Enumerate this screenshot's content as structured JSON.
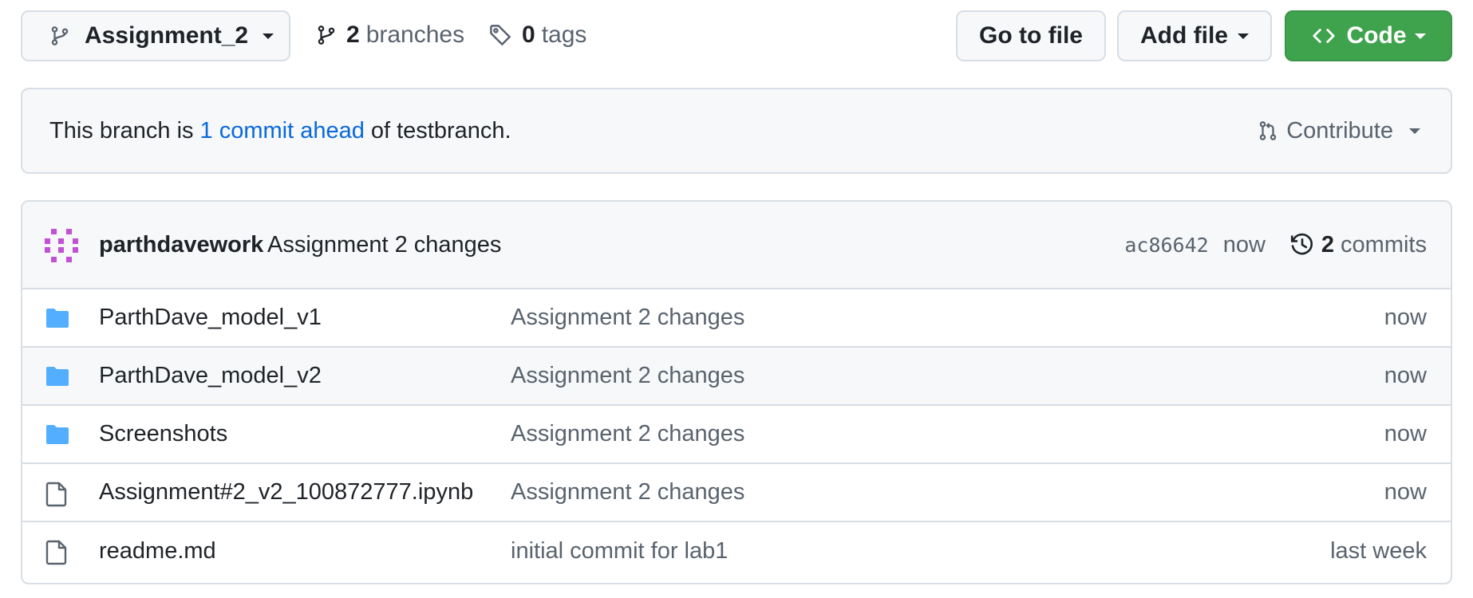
{
  "toolbar": {
    "branch_name": "Assignment_2",
    "branches_count": "2",
    "branches_label": "branches",
    "tags_count": "0",
    "tags_label": "tags",
    "go_to_file_label": "Go to file",
    "add_file_label": "Add file",
    "code_label": "Code"
  },
  "banner": {
    "prefix": "This branch is",
    "link": "1 commit ahead",
    "suffix": "of testbranch.",
    "contribute_label": "Contribute"
  },
  "latest_commit": {
    "author": "parthdavework",
    "message": "Assignment 2 changes",
    "sha": "ac86642",
    "time": "now",
    "commits_count": "2",
    "commits_label": "commits"
  },
  "files": [
    {
      "type": "folder",
      "name": "ParthDave_model_v1",
      "commit": "Assignment 2 changes",
      "time": "now"
    },
    {
      "type": "folder",
      "name": "ParthDave_model_v2",
      "commit": "Assignment 2 changes",
      "time": "now"
    },
    {
      "type": "folder",
      "name": "Screenshots",
      "commit": "Assignment 2 changes",
      "time": "now"
    },
    {
      "type": "file",
      "name": "Assignment#2_v2_100872777.ipynb",
      "commit": "Assignment 2 changes",
      "time": "now"
    },
    {
      "type": "file",
      "name": "readme.md",
      "commit": "initial commit for lab1",
      "time": "last week"
    }
  ],
  "colors": {
    "code_button": "#3fa34d",
    "link": "#0969da",
    "folder_icon": "#54aeff",
    "avatar": "#c251d6"
  },
  "icons": {
    "branch": "git-branch-icon",
    "tag": "tag-icon",
    "code": "code-icon",
    "pull_request": "git-pull-request-icon",
    "history": "history-icon",
    "folder": "folder-icon",
    "file": "file-icon"
  }
}
